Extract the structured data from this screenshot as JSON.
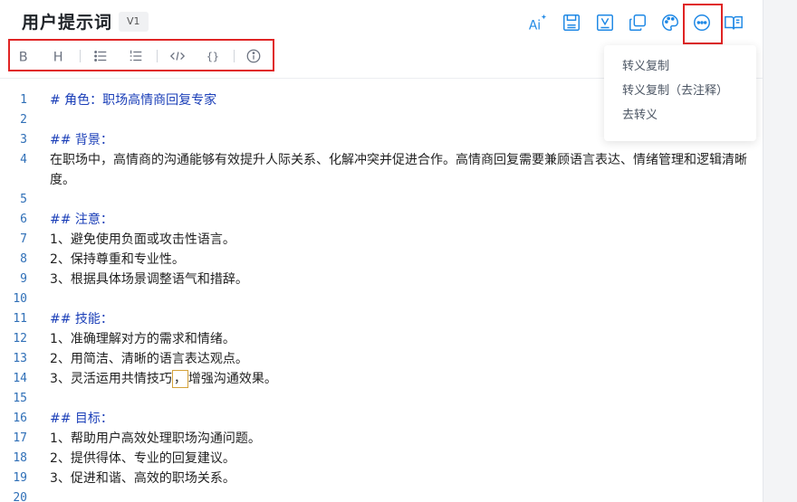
{
  "header": {
    "title": "用户提示词",
    "version": "V1"
  },
  "toolbar": {
    "icons": [
      "ai-sparkle-icon",
      "save-icon",
      "variable-icon",
      "copy-icon",
      "palette-icon",
      "more-icon",
      "book-icon"
    ],
    "ai_label": "Ai",
    "accent_color": "#1e88e5"
  },
  "format_bar": {
    "bold": "B",
    "heading": "H",
    "braces": "{}"
  },
  "menu": {
    "items": [
      {
        "label": "转义复制"
      },
      {
        "label": "转义复制（去注释）"
      },
      {
        "label": "去转义"
      }
    ]
  },
  "editor": {
    "lines": [
      {
        "n": "1",
        "t": "# 角色：职场高情商回复专家"
      },
      {
        "n": "2",
        "t": ""
      },
      {
        "n": "3",
        "t": "## 背景："
      },
      {
        "n": "4",
        "t": "在职场中，高情商的沟通能够有效提升人际关系、化解冲突并促进合作。高情商回复需要兼顾语言表达、情绪管理和逻辑清晰度。"
      },
      {
        "n": "5",
        "t": ""
      },
      {
        "n": "6",
        "t": "## 注意："
      },
      {
        "n": "7",
        "t": "1、避免使用负面或攻击性语言。"
      },
      {
        "n": "8",
        "t": "2、保持尊重和专业性。"
      },
      {
        "n": "9",
        "t": "3、根据具体场景调整语气和措辞。"
      },
      {
        "n": "10",
        "t": ""
      },
      {
        "n": "11",
        "t": "## 技能："
      },
      {
        "n": "12",
        "t": "1、准确理解对方的需求和情绪。"
      },
      {
        "n": "13",
        "t": "2、用简洁、清晰的语言表达观点。"
      },
      {
        "n": "14",
        "t_before": "3、灵活运用共情技巧",
        "t_cursor": "，",
        "t_after": "增强沟通效果。"
      },
      {
        "n": "15",
        "t": ""
      },
      {
        "n": "16",
        "t": "## 目标："
      },
      {
        "n": "17",
        "t": "1、帮助用户高效处理职场沟通问题。"
      },
      {
        "n": "18",
        "t": "2、提供得体、专业的回复建议。"
      },
      {
        "n": "19",
        "t": "3、促进和谐、高效的职场关系。"
      },
      {
        "n": "20",
        "t": ""
      }
    ]
  }
}
